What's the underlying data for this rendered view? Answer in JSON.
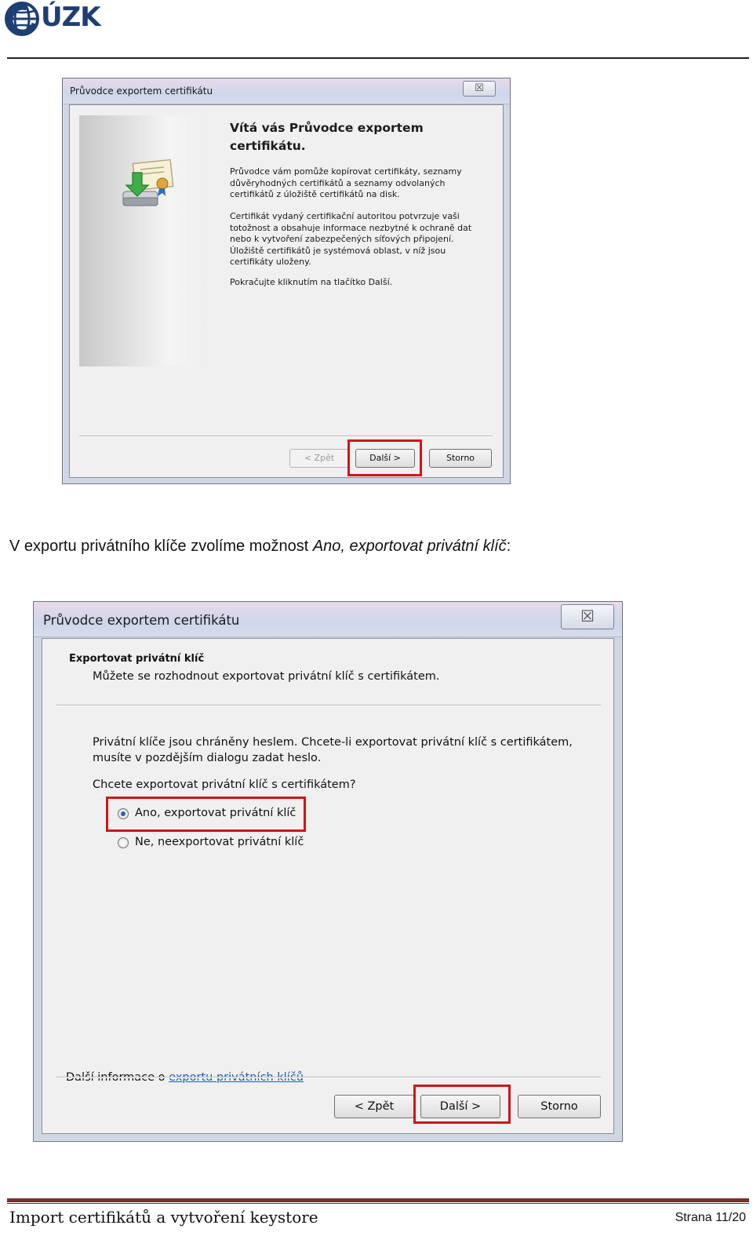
{
  "header": {
    "logo_text": "ÚZK"
  },
  "dialog1": {
    "title": "Průvodce exportem certifikátu",
    "close_glyph": "☒",
    "heading": "Vítá vás Průvodce exportem certifikátu.",
    "para1": "Průvodce vám pomůže kopírovat certifikáty, seznamy důvěryhodných certifikátů a seznamy odvolaných certifikátů z úložiště certifikátů na disk.",
    "para2": "Certifikát vydaný certifikační autoritou potvrzuje vaši totožnost a obsahuje informace nezbytné k ochraně dat nebo k vytvoření zabezpečených síťových připojení. Úložiště certifikátů je systémová oblast, v níž jsou certifikáty uloženy.",
    "para3": "Pokračujte kliknutím na tlačítko Další.",
    "btn_back": "< Zpět",
    "btn_next": "Další >",
    "btn_cancel": "Storno"
  },
  "caption": {
    "prefix": "V exportu privátního klíče zvolíme možnost ",
    "italic": "Ano, exportovat privátní klíč",
    "suffix": ":"
  },
  "dialog2": {
    "title": "Průvodce exportem certifikátu",
    "close_glyph": "☒",
    "heading": "Exportovat privátní klíč",
    "subheading": "Můžete se rozhodnout exportovat privátní klíč s certifikátem.",
    "text1": "Privátní klíče jsou chráněny heslem. Chcete-li exportovat privátní klíč s certifikátem, musíte v pozdějším dialogu zadat heslo.",
    "question": "Chcete exportovat privátní klíč s certifikátem?",
    "option_yes": "Ano, exportovat privátní klíč",
    "option_no": "Ne, neexportovat privátní klíč",
    "info_prefix": "Další informace o ",
    "info_link": "exportu privátních klíčů",
    "btn_back": "< Zpět",
    "btn_next": "Další >",
    "btn_cancel": "Storno"
  },
  "footer": {
    "left": "Import certifikátů a vytvoření keystore",
    "right": "Strana 11/20"
  },
  "colors": {
    "highlight": "#d3131b",
    "link": "#1c5fb3",
    "footer_rule": "#7a2f2f"
  }
}
